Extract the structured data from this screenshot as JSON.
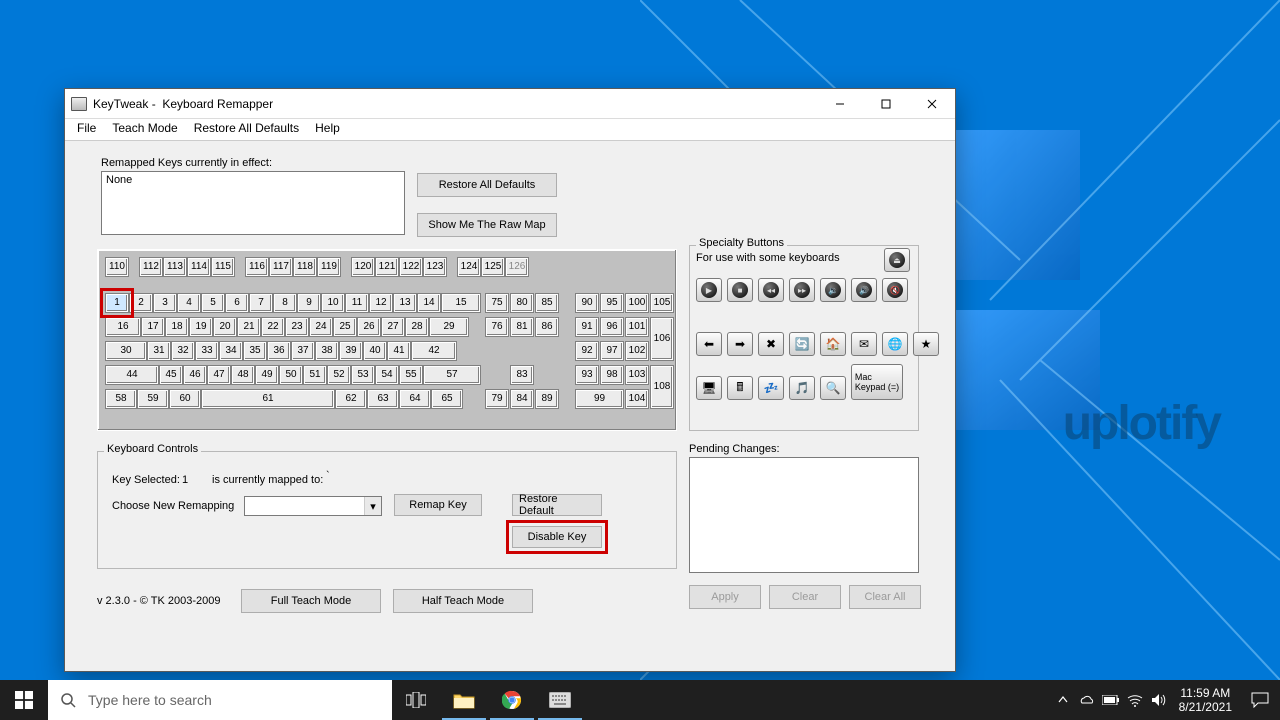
{
  "desktop_watermark": "uplotify",
  "window": {
    "title": "KeyTweak -  Keyboard Remapper",
    "menu": [
      "File",
      "Teach Mode",
      "Restore All Defaults",
      "Help"
    ]
  },
  "remapped": {
    "label": "Remapped Keys currently in effect:",
    "content": "None"
  },
  "buttons": {
    "restore_all": "Restore All Defaults",
    "show_raw": "Show Me The Raw Map",
    "remap": "Remap Key",
    "restore_default": "Restore Default",
    "disable": "Disable Key",
    "full_teach": "Full Teach Mode",
    "half_teach": "Half Teach Mode",
    "apply": "Apply",
    "clear": "Clear",
    "clear_all": "Clear All",
    "mac_keypad": "Mac\nKeypad (=)"
  },
  "kb": {
    "frow": [
      "110",
      "",
      "112",
      "113",
      "114",
      "115",
      "",
      "116",
      "117",
      "118",
      "119",
      "",
      "120",
      "121",
      "122",
      "123",
      "",
      "124",
      "125",
      "126"
    ],
    "row1": [
      "1",
      "2",
      "3",
      "4",
      "5",
      "6",
      "7",
      "8",
      "9",
      "10",
      "11",
      "12",
      "13",
      "14",
      "15"
    ],
    "row2": [
      "16",
      "17",
      "18",
      "19",
      "20",
      "21",
      "22",
      "23",
      "24",
      "25",
      "26",
      "27",
      "28",
      "29"
    ],
    "row3": [
      "30",
      "31",
      "32",
      "33",
      "34",
      "35",
      "36",
      "37",
      "38",
      "39",
      "40",
      "41",
      "42"
    ],
    "row4": [
      "44",
      "45",
      "46",
      "47",
      "48",
      "49",
      "50",
      "51",
      "52",
      "53",
      "54",
      "55",
      "57"
    ],
    "row5": [
      "58",
      "59",
      "60",
      "61",
      "62",
      "63",
      "64",
      "65"
    ],
    "nav1": [
      "75",
      "80",
      "85"
    ],
    "nav2": [
      "76",
      "81",
      "86"
    ],
    "nav3": [
      "83"
    ],
    "nav4": [
      "79",
      "84",
      "89"
    ],
    "np1": [
      "90",
      "95",
      "100",
      "105"
    ],
    "np2": [
      "91",
      "96",
      "101",
      "106"
    ],
    "np3": [
      "92",
      "97",
      "102"
    ],
    "np4": [
      "93",
      "98",
      "103",
      "108"
    ],
    "np5": [
      "99",
      "104"
    ]
  },
  "controls_group": "Keyboard Controls",
  "key_selected_label": "Key Selected:",
  "key_selected_value": "1",
  "mapped_label": "is currently mapped to:",
  "mapped_value": "`",
  "choose_label": "Choose New Remapping",
  "specialty": {
    "title": "Specialty Buttons",
    "subtitle": "For use with some keyboards"
  },
  "spec_icons": {
    "top_extra": "eject-icon",
    "media": [
      "play-icon",
      "stop-icon",
      "prev-icon",
      "next-icon",
      "vol-down-icon",
      "vol-up-icon",
      "mute-icon"
    ],
    "web": [
      "back-icon",
      "forward-icon",
      "stop-nav-icon",
      "refresh-icon",
      "home-icon",
      "mail-icon",
      "web-icon",
      "favorites-icon"
    ],
    "sys": [
      "mycomputer-icon",
      "calculator-icon",
      "sleep-icon",
      "media-icon",
      "search-icon"
    ]
  },
  "pending_label": "Pending Changes:",
  "version": "v 2.3.0 - © TK 2003-2009",
  "taskbar": {
    "search_placeholder": "Type here to search",
    "clock_time": "11:59 AM",
    "clock_date": "8/21/2021"
  }
}
